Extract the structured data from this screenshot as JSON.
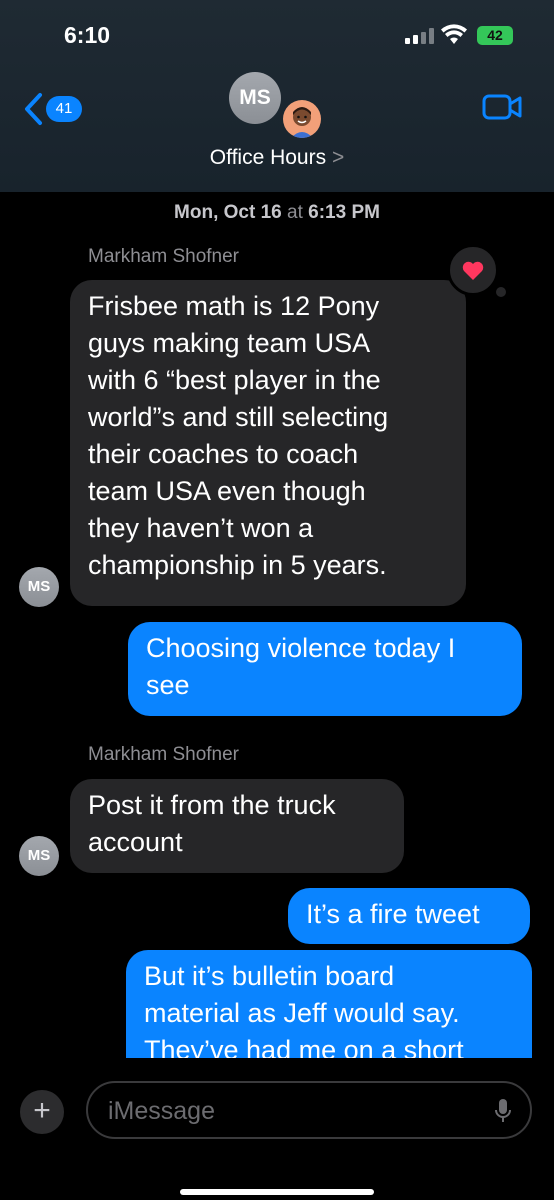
{
  "status": {
    "time": "6:10",
    "battery": "42"
  },
  "header": {
    "back_count": "41",
    "avatar_initials": "MS",
    "title": "Office Hours",
    "title_chevron": ">"
  },
  "thread": {
    "timestamp_day": "Mon, Oct 16",
    "timestamp_at": " at ",
    "timestamp_time": "6:13 PM",
    "messages": [
      {
        "sender": "Markham Shofner",
        "text": "Frisbee math is 12 Pony\nguys making team USA\nwith 6 “best player in the\nworld”s and still selecting\ntheir coaches to coach\nteam USA even though\nthey haven’t won a\nchampionship in 5 years.",
        "avatar": "MS",
        "reaction": "heart"
      },
      {
        "text": "Choosing violence today I\nsee"
      },
      {
        "sender": "Markham Shofner",
        "text": "Post it from the truck\naccount",
        "avatar": "MS"
      },
      {
        "text": "It’s a fire tweet"
      },
      {
        "text": "But it’s bulletin board\nmaterial as Jeff would say.\nThey’ve had me on a short"
      }
    ]
  },
  "composer": {
    "placeholder": "iMessage",
    "plus_label": "+"
  },
  "colors": {
    "accent": "#0a84ff",
    "incoming": "#262628",
    "reaction": "#ff375f"
  }
}
